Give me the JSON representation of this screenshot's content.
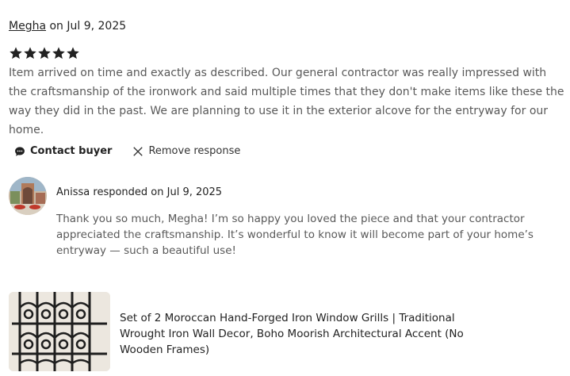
{
  "review": {
    "reviewer": "Megha",
    "date_text": " on Jul 9, 2025",
    "rating": 5,
    "text": "Item arrived on time and exactly as described. Our general contractor was really impressed with the craftsmanship of the ironwork and said multiple times that they don't make items like these the way they did in the past. We are planning to use it in the exterior alcove for the entryway for our home."
  },
  "actions": {
    "contact_label": "Contact buyer",
    "remove_label": "Remove response"
  },
  "response": {
    "header": "Anissa responded on Jul 9, 2025",
    "text": "Thank you so much, Megha! I’m so happy you loved the piece and that your contractor appreciated the craftsmanship. It’s wonderful to know it will become part of your home’s entryway — such a beautiful use!"
  },
  "product": {
    "title": "Set of 2 Moroccan Hand-Forged Iron Window Grills | Traditional Wrought Iron Wall Decor, Boho Moorish Architectural Accent (No Wooden Frames)"
  },
  "colors": {
    "text_primary": "#222222",
    "text_secondary": "#595959",
    "star": "#222222"
  },
  "icons": {
    "star": "star-icon",
    "contact": "chat-bubble-icon",
    "remove": "close-icon"
  }
}
